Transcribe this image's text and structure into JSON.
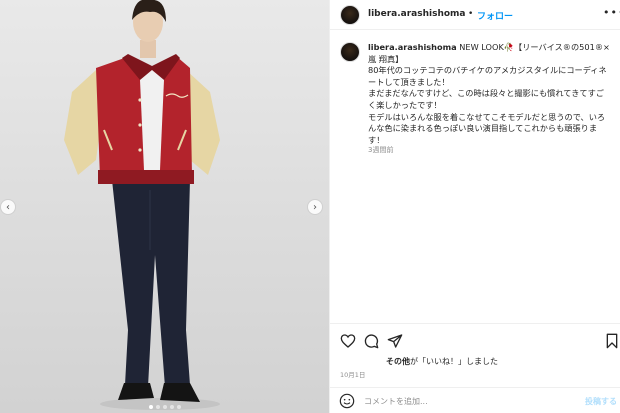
{
  "media": {
    "dots_total": 5,
    "dots_active_index": 0,
    "prev_icon": "chevron-left-icon",
    "next_icon": "chevron-right-icon"
  },
  "header": {
    "username": "libera.arashishoma",
    "separator": "•",
    "follow_label": "フォロー",
    "more_icon": "more-horizontal-icon"
  },
  "post": {
    "username": "libera.arashishoma",
    "caption": "NEW LOOK🥀【リーバイス®の501®×嵐 翔真】\n80年代のコッテコテのバチイケのアメカジスタイルにコーディネートして頂きました！\nまだまだなんですけど、この時は段々と撮影にも慣れてきてすごく楽しかったです！\nモデルはいろんな服を着こなせてこそモデルだと思うので、いろんな色に染まれる色っぽい良い演目指してこれからも頑張ります！",
    "time_ago": "3週間前"
  },
  "actions": {
    "like_icon": "heart-icon",
    "comment_icon": "comment-icon",
    "share_icon": "share-icon",
    "save_icon": "bookmark-icon"
  },
  "likes": {
    "bold": "その他",
    "text": "が「いいね！」しました"
  },
  "date": "10月1日",
  "comment": {
    "placeholder": "コメントを追加...",
    "post_label": "投稿する"
  },
  "colors": {
    "accent": "#0095f6",
    "jacket_red": "#b3232c",
    "sleeve_cream": "#e6d6a4",
    "jeans": "#1f2435"
  }
}
